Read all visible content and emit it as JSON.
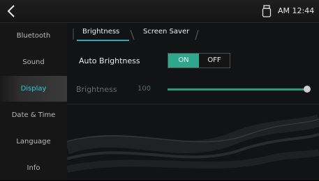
{
  "status": {
    "clock": "AM 12:44",
    "icons": {
      "back": "chevron-left-icon",
      "status": "usb-drive-icon"
    }
  },
  "sidebar": {
    "items": [
      {
        "label": "Bluetooth",
        "active": false
      },
      {
        "label": "Sound",
        "active": false
      },
      {
        "label": "Display",
        "active": true
      },
      {
        "label": "Date & Time",
        "active": false
      },
      {
        "label": "Language",
        "active": false
      },
      {
        "label": "Info",
        "active": false
      }
    ]
  },
  "tabs": [
    {
      "label": "Brightness",
      "selected": true
    },
    {
      "label": "Screen Saver",
      "selected": false
    }
  ],
  "auto_brightness": {
    "label": "Auto Brightness",
    "on_label": "ON",
    "off_label": "OFF",
    "selected": "ON"
  },
  "brightness": {
    "label": "Brightness",
    "value": "100",
    "level": 1.0
  },
  "colors": {
    "accent": "#33c9e6",
    "toggle_on": "#2ea88c",
    "slider_fill": "#2f9a7f",
    "background": "#121314"
  }
}
